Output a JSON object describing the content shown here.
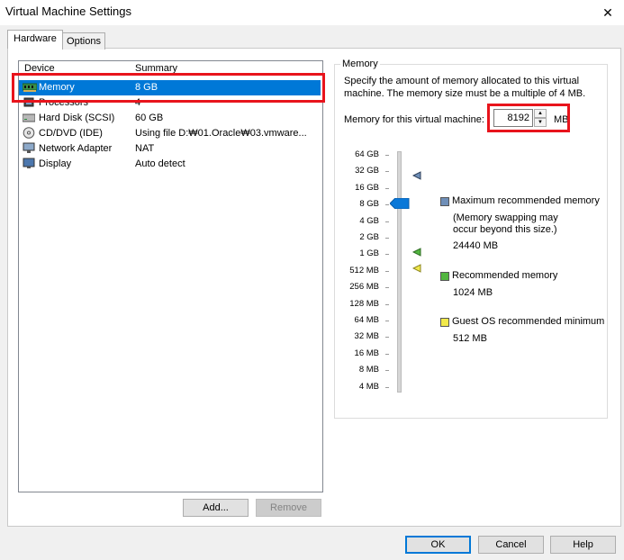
{
  "window": {
    "title": "Virtual Machine Settings",
    "close_glyph": "✕"
  },
  "tabs": [
    {
      "label": "Hardware"
    },
    {
      "label": "Options"
    }
  ],
  "device_list": {
    "headers": {
      "device": "Device",
      "summary": "Summary"
    },
    "rows": [
      {
        "device": "Memory",
        "summary": "8 GB",
        "icon": "memory-icon"
      },
      {
        "device": "Processors",
        "summary": "4",
        "icon": "processor-icon"
      },
      {
        "device": "Hard Disk (SCSI)",
        "summary": "60 GB",
        "icon": "hard-disk-icon"
      },
      {
        "device": "CD/DVD (IDE)",
        "summary": "Using file D:₩01.Oracle₩03.vmware...",
        "icon": "cd-dvd-icon"
      },
      {
        "device": "Network Adapter",
        "summary": "NAT",
        "icon": "network-adapter-icon"
      },
      {
        "device": "Display",
        "summary": "Auto detect",
        "icon": "display-icon"
      }
    ]
  },
  "buttons": {
    "add": "Add...",
    "remove": "Remove",
    "ok": "OK",
    "cancel": "Cancel",
    "help": "Help"
  },
  "memory": {
    "group_label": "Memory",
    "description": "Specify the amount of memory allocated to this virtual machine. The memory size must be a multiple of 4 MB.",
    "field_label": "Memory for this virtual machine:",
    "value": "8192",
    "unit": "MB",
    "slider_labels": [
      "64 GB",
      "32 GB",
      "16 GB",
      "8 GB",
      "4 GB",
      "2 GB",
      "1 GB",
      "512 MB",
      "256 MB",
      "128 MB",
      "64 MB",
      "32 MB",
      "16 MB",
      "8 MB",
      "4 MB"
    ],
    "slider_selected_label": "8 GB",
    "legend": {
      "max": {
        "title": "Maximum recommended memory",
        "note1": "(Memory swapping may",
        "note2": "occur beyond this size.)",
        "value": "24440 MB",
        "color": "#6f8fb8"
      },
      "recommended": {
        "title": "Recommended memory",
        "value": "1024 MB",
        "color": "#52b640"
      },
      "guest_min": {
        "title": "Guest OS recommended minimum",
        "value": "512 MB",
        "color": "#f1e94a"
      }
    }
  },
  "colors": {
    "selection": "#0078d7",
    "highlight_box": "#e8141c"
  }
}
